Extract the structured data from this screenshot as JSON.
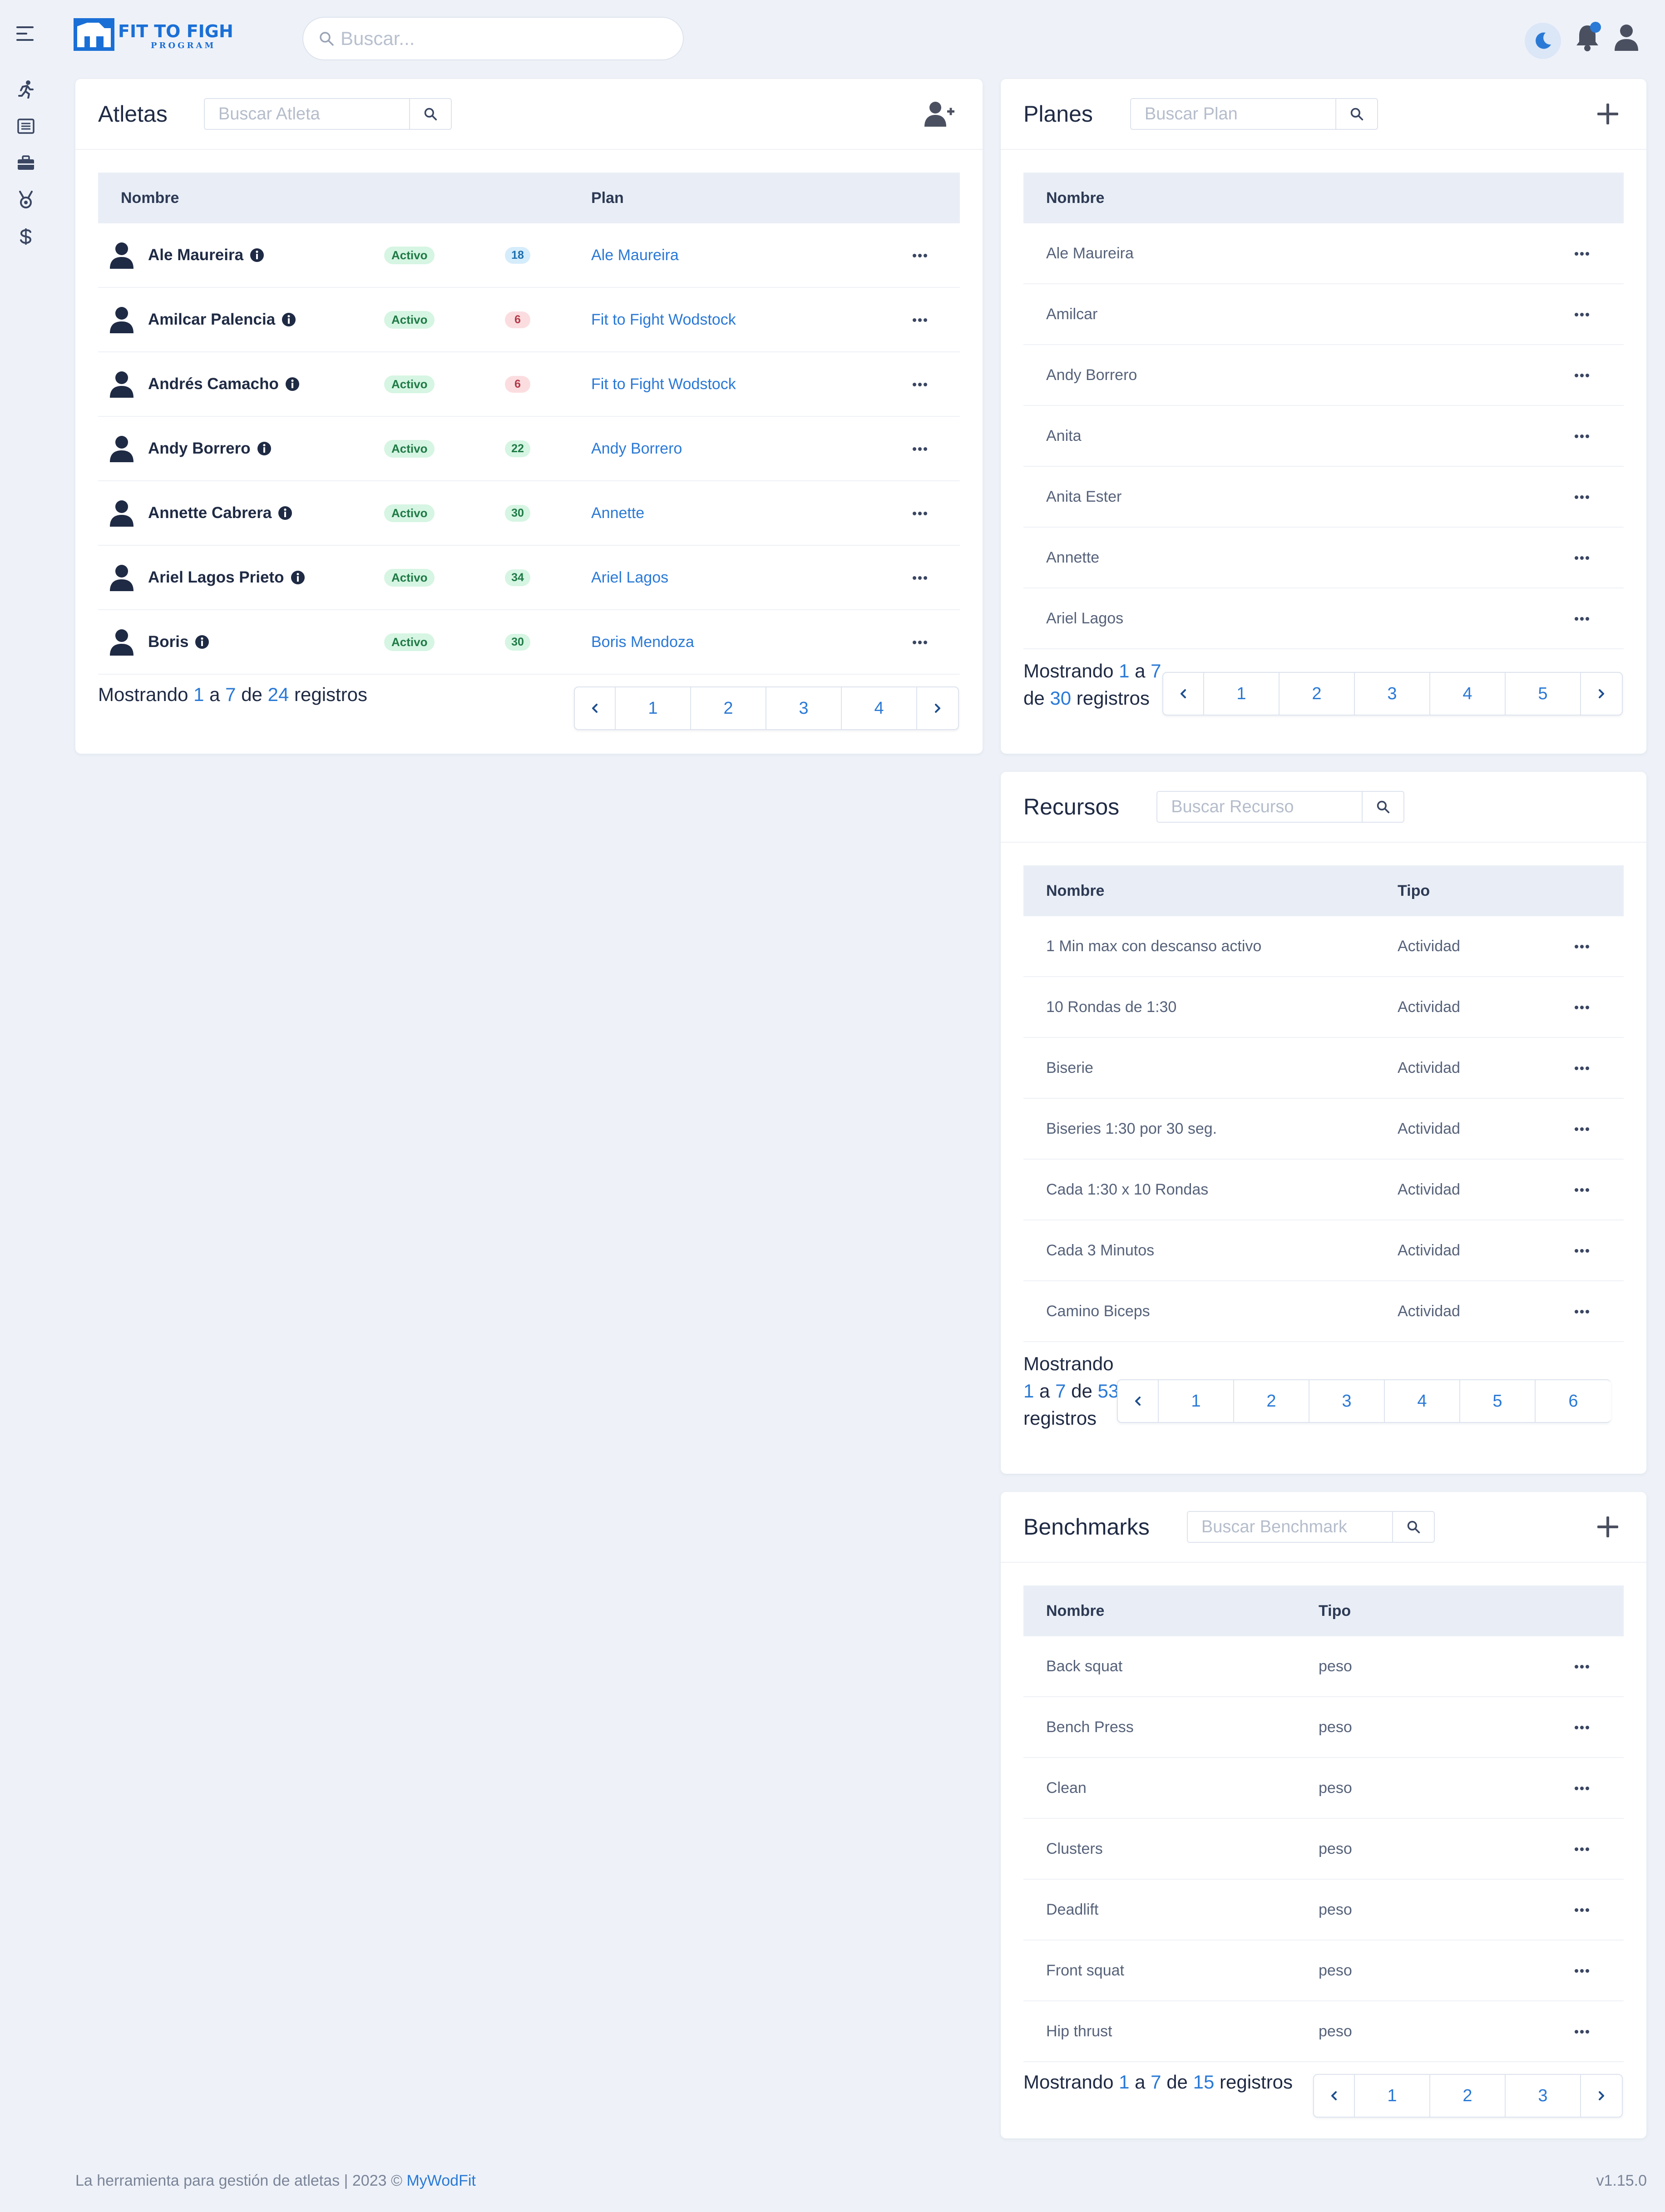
{
  "app": {
    "logo_text": "FIT TO FIGHT",
    "logo_sub": "PROGRAM",
    "search_placeholder": "Buscar..."
  },
  "colors": {
    "accent": "#2a79d6",
    "background": "#eef2f8",
    "active_badge": "#d6f5e3",
    "header_row": "#e9eef6"
  },
  "nav": {
    "items": [
      {
        "icon": "running-icon"
      },
      {
        "icon": "list-icon"
      },
      {
        "icon": "briefcase-icon"
      },
      {
        "icon": "medal-icon"
      },
      {
        "icon": "dollar-icon"
      }
    ]
  },
  "atletas": {
    "title": "Atletas",
    "search_placeholder": "Buscar Atleta",
    "col_name": "Nombre",
    "col_plan": "Plan",
    "rows": [
      {
        "name": "Ale Maureira",
        "status": "Activo",
        "count": "18",
        "count_color": "blue",
        "plan": "Ale Maureira"
      },
      {
        "name": "Amilcar Palencia",
        "status": "Activo",
        "count": "6",
        "count_color": "red",
        "plan": "Fit to Fight Wodstock"
      },
      {
        "name": "Andrés Camacho",
        "status": "Activo",
        "count": "6",
        "count_color": "red",
        "plan": "Fit to Fight Wodstock"
      },
      {
        "name": "Andy Borrero",
        "status": "Activo",
        "count": "22",
        "count_color": "green",
        "plan": "Andy Borrero"
      },
      {
        "name": "Annette Cabrera",
        "status": "Activo",
        "count": "30",
        "count_color": "green",
        "plan": "Annette"
      },
      {
        "name": "Ariel Lagos Prieto",
        "status": "Activo",
        "count": "34",
        "count_color": "green",
        "plan": "Ariel Lagos"
      },
      {
        "name": "Boris",
        "status": "Activo",
        "count": "30",
        "count_color": "green",
        "plan": "Boris Mendoza"
      }
    ],
    "footer": {
      "pre": "Mostrando",
      "from": "1",
      "a": "a",
      "to": "7",
      "de": "de",
      "total": "24",
      "post": "registros"
    },
    "pages": [
      "1",
      "2",
      "3",
      "4"
    ]
  },
  "planes": {
    "title": "Planes",
    "search_placeholder": "Buscar Plan",
    "col_name": "Nombre",
    "rows": [
      "Ale Maureira",
      "Amilcar",
      "Andy Borrero",
      "Anita",
      "Anita Ester",
      "Annette",
      "Ariel Lagos"
    ],
    "footer": {
      "pre": "Mostrando",
      "from": "1",
      "a": "a",
      "to": "7",
      "de": "de",
      "total": "30",
      "post": "registros"
    },
    "pages": [
      "1",
      "2",
      "3",
      "4",
      "5"
    ]
  },
  "recursos": {
    "title": "Recursos",
    "search_placeholder": "Buscar Recurso",
    "col_name": "Nombre",
    "col_type": "Tipo",
    "rows": [
      {
        "name": "1 Min max con descanso activo",
        "type": "Actividad"
      },
      {
        "name": "10 Rondas de 1:30",
        "type": "Actividad"
      },
      {
        "name": "Biserie",
        "type": "Actividad"
      },
      {
        "name": "Biseries 1:30 por 30 seg.",
        "type": "Actividad"
      },
      {
        "name": "Cada 1:30 x 10 Rondas",
        "type": "Actividad"
      },
      {
        "name": "Cada 3 Minutos",
        "type": "Actividad"
      },
      {
        "name": "Camino Biceps",
        "type": "Actividad"
      }
    ],
    "footer": {
      "pre": "Mostrando",
      "from": "1",
      "a": "a",
      "to": "7",
      "de": "de",
      "total": "53",
      "post": "registros"
    },
    "pages": [
      "1",
      "2",
      "3",
      "4",
      "5",
      "6"
    ]
  },
  "benchmarks": {
    "title": "Benchmarks",
    "search_placeholder": "Buscar Benchmark",
    "col_name": "Nombre",
    "col_type": "Tipo",
    "rows": [
      {
        "name": "Back squat",
        "type": "peso"
      },
      {
        "name": "Bench Press",
        "type": "peso"
      },
      {
        "name": "Clean",
        "type": "peso"
      },
      {
        "name": "Clusters",
        "type": "peso"
      },
      {
        "name": "Deadlift",
        "type": "peso"
      },
      {
        "name": "Front squat",
        "type": "peso"
      },
      {
        "name": "Hip thrust",
        "type": "peso"
      }
    ],
    "footer": {
      "pre": "Mostrando",
      "from": "1",
      "a": "a",
      "to": "7",
      "de": "de",
      "total": "15",
      "post": "registros"
    },
    "pages": [
      "1",
      "2",
      "3"
    ]
  },
  "footer": {
    "text": "La herramienta para gestión de atletas | 2023 ©",
    "brand": "MyWodFit",
    "version": "v1.15.0"
  }
}
